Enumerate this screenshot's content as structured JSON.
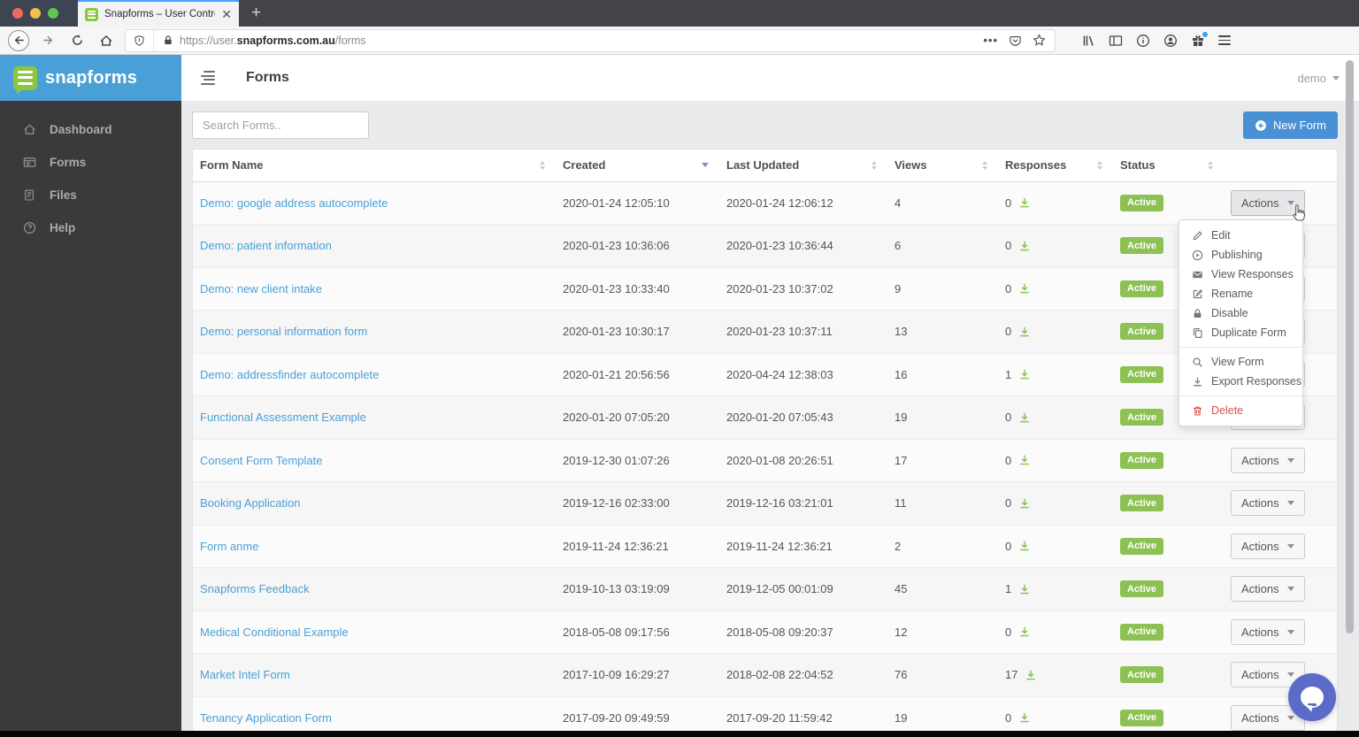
{
  "browser": {
    "tab_title": "Snapforms – User Control Panel",
    "url_prefix": "https://user.",
    "url_domain": "snapforms.com.au",
    "url_path": "/forms"
  },
  "sidebar": {
    "brand": "snapforms",
    "items": [
      {
        "label": "Dashboard",
        "icon": "home-icon"
      },
      {
        "label": "Forms",
        "icon": "forms-icon"
      },
      {
        "label": "Files",
        "icon": "file-icon"
      },
      {
        "label": "Help",
        "icon": "help-icon"
      }
    ]
  },
  "header": {
    "title": "Forms",
    "account": "demo"
  },
  "toolbar": {
    "search_placeholder": "Search Forms..",
    "new_form_label": "New Form"
  },
  "table": {
    "actions_label": "Actions",
    "columns": [
      {
        "label": "Form Name",
        "sorted": false
      },
      {
        "label": "Created",
        "sorted": true
      },
      {
        "label": "Last Updated",
        "sorted": false
      },
      {
        "label": "Views",
        "sorted": false
      },
      {
        "label": "Responses",
        "sorted": false
      },
      {
        "label": "Status",
        "sorted": false
      }
    ],
    "rows": [
      {
        "name": "Demo: google address autocomplete",
        "created": "2020-01-24 12:05:10",
        "updated": "2020-01-24 12:06:12",
        "views": "4",
        "responses": "0",
        "status": "Active"
      },
      {
        "name": "Demo: patient information",
        "created": "2020-01-23 10:36:06",
        "updated": "2020-01-23 10:36:44",
        "views": "6",
        "responses": "0",
        "status": "Active"
      },
      {
        "name": "Demo: new client intake",
        "created": "2020-01-23 10:33:40",
        "updated": "2020-01-23 10:37:02",
        "views": "9",
        "responses": "0",
        "status": "Active"
      },
      {
        "name": "Demo: personal information form",
        "created": "2020-01-23 10:30:17",
        "updated": "2020-01-23 10:37:11",
        "views": "13",
        "responses": "0",
        "status": "Active"
      },
      {
        "name": "Demo: addressfinder autocomplete",
        "created": "2020-01-21 20:56:56",
        "updated": "2020-04-24 12:38:03",
        "views": "16",
        "responses": "1",
        "status": "Active"
      },
      {
        "name": "Functional Assessment Example",
        "created": "2020-01-20 07:05:20",
        "updated": "2020-01-20 07:05:43",
        "views": "19",
        "responses": "0",
        "status": "Active"
      },
      {
        "name": "Consent Form Template",
        "created": "2019-12-30 01:07:26",
        "updated": "2020-01-08 20:26:51",
        "views": "17",
        "responses": "0",
        "status": "Active"
      },
      {
        "name": "Booking Application",
        "created": "2019-12-16 02:33:00",
        "updated": "2019-12-16 03:21:01",
        "views": "11",
        "responses": "0",
        "status": "Active"
      },
      {
        "name": "Form anme",
        "created": "2019-11-24 12:36:21",
        "updated": "2019-11-24 12:36:21",
        "views": "2",
        "responses": "0",
        "status": "Active"
      },
      {
        "name": "Snapforms Feedback",
        "created": "2019-10-13 03:19:09",
        "updated": "2019-12-05 00:01:09",
        "views": "45",
        "responses": "1",
        "status": "Active"
      },
      {
        "name": "Medical Conditional Example",
        "created": "2018-05-08 09:17:56",
        "updated": "2018-05-08 09:20:37",
        "views": "12",
        "responses": "0",
        "status": "Active"
      },
      {
        "name": "Market Intel Form",
        "created": "2017-10-09 16:29:27",
        "updated": "2018-02-08 22:04:52",
        "views": "76",
        "responses": "17",
        "status": "Active"
      },
      {
        "name": "Tenancy Application Form",
        "created": "2017-09-20 09:49:59",
        "updated": "2017-09-20 11:59:42",
        "views": "19",
        "responses": "0",
        "status": "Active"
      }
    ]
  },
  "menu": {
    "groups": [
      {
        "items": [
          {
            "label": "Edit",
            "icon": "pencil-icon"
          },
          {
            "label": "Publishing",
            "icon": "play-circle-icon"
          },
          {
            "label": "View Responses",
            "icon": "envelope-icon"
          },
          {
            "label": "Rename",
            "icon": "pencil-square-icon"
          },
          {
            "label": "Disable",
            "icon": "lock-icon"
          },
          {
            "label": "Duplicate Form",
            "icon": "duplicate-icon"
          }
        ]
      },
      {
        "items": [
          {
            "label": "View Form",
            "icon": "magnifier-icon"
          },
          {
            "label": "Export Responses",
            "icon": "download-icon"
          }
        ]
      },
      {
        "items": [
          {
            "label": "Delete",
            "icon": "trash-icon",
            "danger": true
          }
        ]
      }
    ]
  },
  "colors": {
    "brand_blue": "#4aa0d6",
    "logo_green": "#8cc63e",
    "link_blue": "#4aa0d5",
    "badge_green": "#8dc153",
    "button_blue": "#4a90d5",
    "delete_red": "#d9534f",
    "chat_purple": "#5b6bc7",
    "tab_accent_blue": "#45a1ff"
  }
}
